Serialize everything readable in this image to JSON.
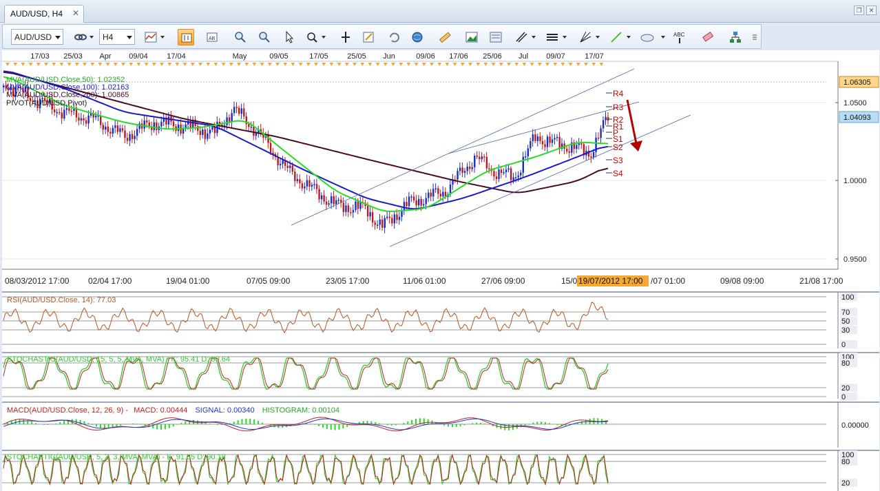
{
  "tab": {
    "title": "AUD/USD, H4"
  },
  "toolbar": {
    "symbol": "AUD/USD",
    "timeframe": "H4"
  },
  "colors": {
    "green": "#22dd22",
    "blue": "#1a1acc",
    "maroon": "#4a0a25",
    "pivot_red": "#cc0000",
    "orange": "#f7a833",
    "price_tag": "#ffd68a",
    "cur_tag": "#b8dcf5"
  },
  "main": {
    "top_dates": [
      "17/03",
      "25/03",
      "Apr",
      "09/04",
      "17/04",
      "May",
      "09/05",
      "17/05",
      "25/05",
      "Jun",
      "09/06",
      "17/06",
      "25/06",
      "Jul",
      "09/07",
      "17/07"
    ],
    "bottom_dates": [
      "08/03/2012 17:00",
      "02/04 17:00",
      "19/04 01:00",
      "07/05 09:00",
      "23/05 17:00",
      "11/06 01:00",
      "27/06 09:00",
      "15/0",
      "/07 01:00",
      "09/08 09:00",
      "21/08 17:00"
    ],
    "cursor_date": "19/07/2012 17:00",
    "legend": [
      {
        "text": "MVA(AUD/USD,Close,50): 1.02352",
        "color": "#22aa22"
      },
      {
        "text": "MVA(AUD/USD,Close,100): 1.02163",
        "color": "#1a1acc"
      },
      {
        "text": "MVA(AUD/USD,Close,200): 1.00865",
        "color": "#4a0a25"
      },
      {
        "text": "PIVOT(AUD/USD,Pivot)",
        "color": "#222222"
      }
    ],
    "price_ticks": [
      "1.0500",
      "1.0000",
      "0.9500"
    ],
    "price_tag": "1.06305",
    "current_price": "1.04093",
    "pivot_labels": [
      "R4",
      "R3",
      "R2",
      "R1",
      "P",
      "S1",
      "S2",
      "S3",
      "S4"
    ]
  },
  "rsi": {
    "legend": "RSI(AUD/USD.Close, 14): 77.03",
    "ticks": [
      "100",
      "70",
      "50",
      "30",
      "0"
    ]
  },
  "stoch1": {
    "legend": "STOCHASTIC(AUD/USD, 15, 5, 5, MVA, MVA) -  K: 95.41  D: 90.64",
    "ticks": [
      "100",
      "80",
      "20",
      "0"
    ]
  },
  "macd": {
    "label": "MACD(AUD/USD.Close, 12, 26, 9) -",
    "macd": "MACD: 0.00444",
    "signal": "SIGNAL: 0.00340",
    "histogram": "HISTOGRAM: 0.00104",
    "tick": "0.00000"
  },
  "stoch2": {
    "legend": "STOCHASTIC(AUD/USD, 5, 3, 3, MVA, MVA) -  K: 91.85  D: 90.18",
    "ticks": [
      "100",
      "80",
      "20"
    ]
  }
}
